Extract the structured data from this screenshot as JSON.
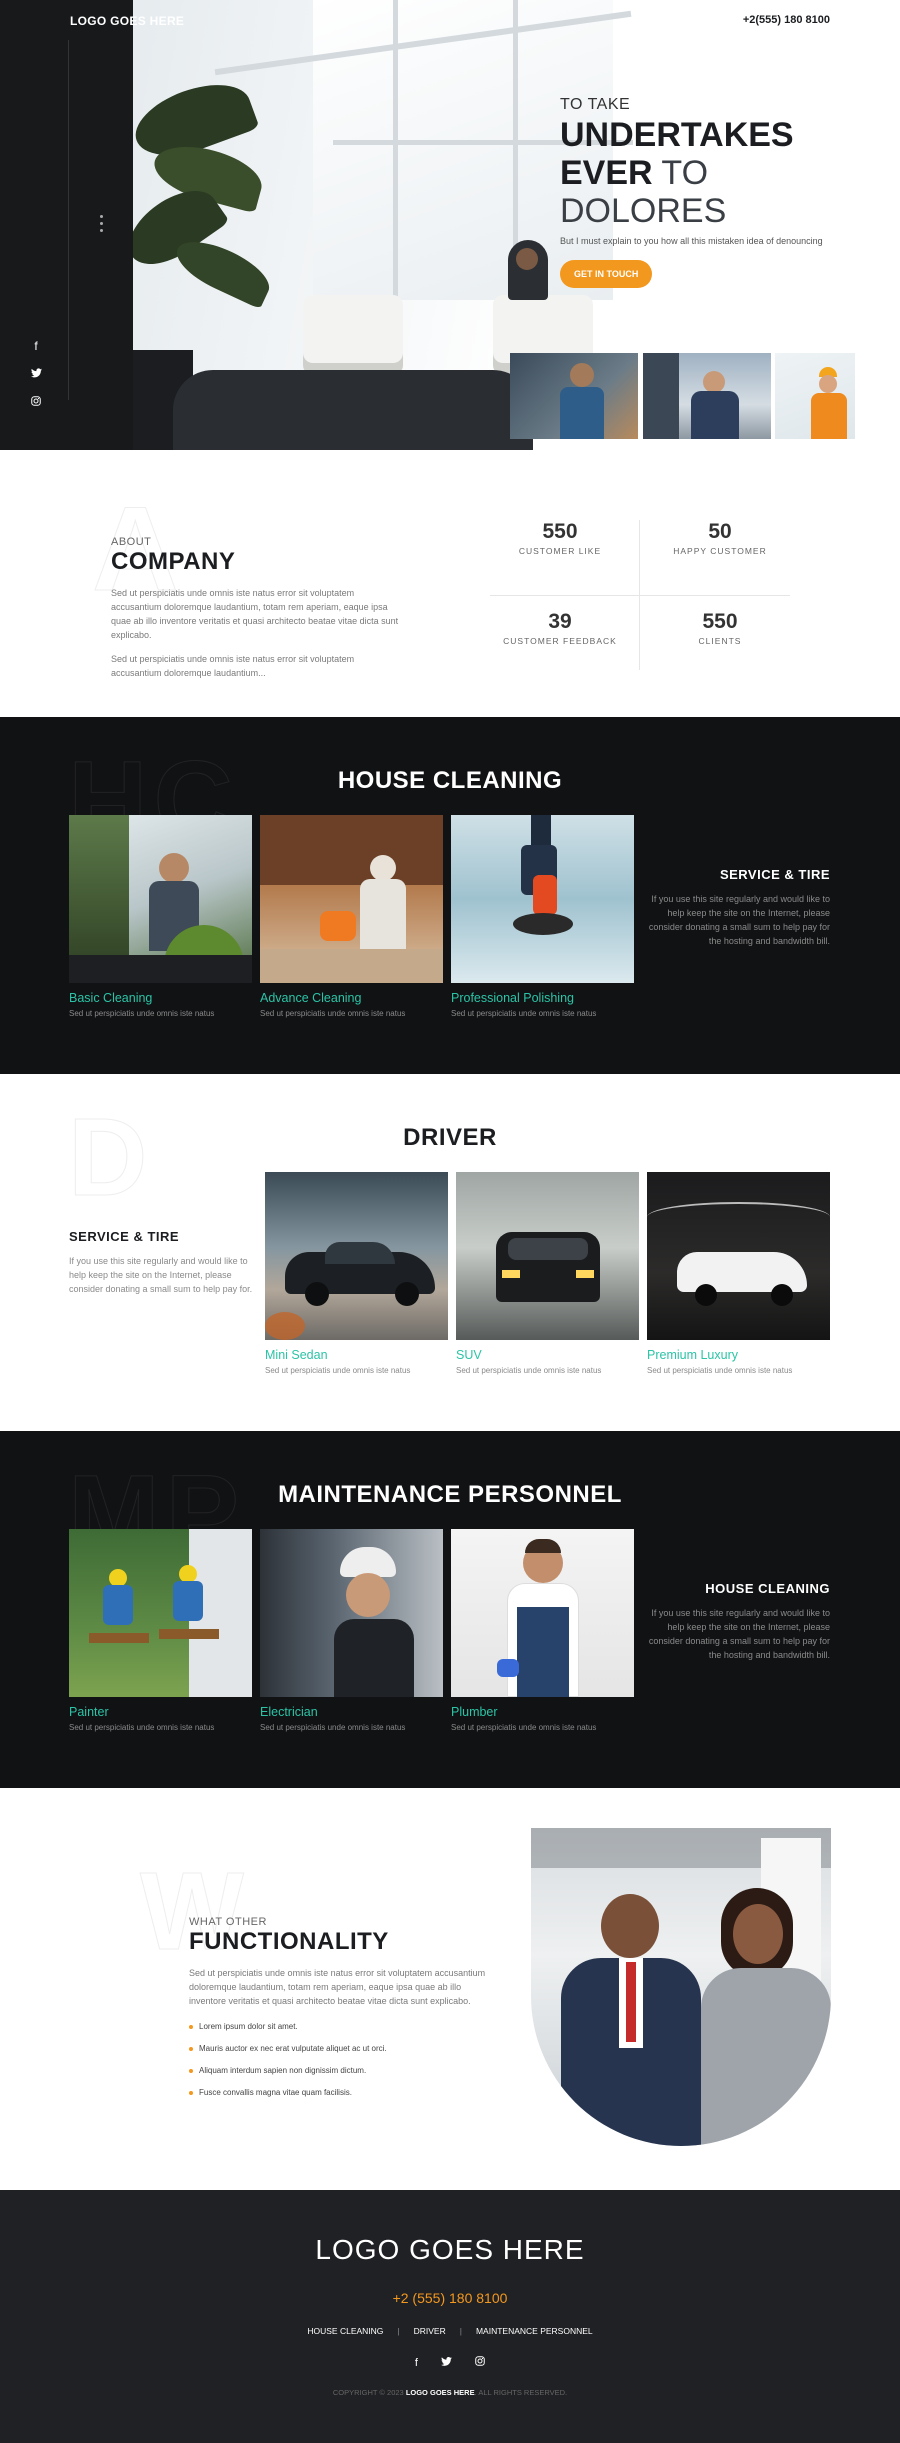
{
  "header": {
    "logo": "LOGO GOES HERE",
    "phone": "+2(555) 180 8100"
  },
  "hero": {
    "eyebrow": "TO TAKE",
    "title_line1": "UNDERTAKES",
    "title_line2_a": "EVER",
    "title_line2_b": " TO DOLORES",
    "subtitle": "But I must explain to you how all this mistaken idea of denouncing",
    "cta": "GET IN TOUCH"
  },
  "about": {
    "eyebrow": "ABOUT",
    "title": "COMPANY",
    "para1": "Sed ut perspiciatis unde omnis iste natus error sit voluptatem accusantium doloremque laudantium, totam rem aperiam, eaque ipsa quae ab illo inventore veritatis et quasi architecto beatae vitae dicta sunt explicabo.",
    "para2": "Sed ut perspiciatis unde omnis iste natus error sit voluptatem accusantium doloremque laudantium...",
    "stats": [
      {
        "num": "550",
        "label": "CUSTOMER LIKE"
      },
      {
        "num": "50",
        "label": "HAPPY CUSTOMER"
      },
      {
        "num": "39",
        "label": "CUSTOMER FEEDBACK"
      },
      {
        "num": "550",
        "label": "CLIENTS"
      }
    ]
  },
  "house_cleaning": {
    "title": "HOUSE CLEANING",
    "cards": [
      {
        "title": "Basic Cleaning",
        "desc": "Sed ut perspiciatis unde omnis iste natus"
      },
      {
        "title": "Advance Cleaning",
        "desc": "Sed ut perspiciatis unde omnis iste natus"
      },
      {
        "title": "Professional Polishing",
        "desc": "Sed ut perspiciatis unde omnis iste natus"
      }
    ],
    "side_title": "SERVICE & TIRE",
    "side_text": "If you use this site regularly and would like to help keep the site on the Internet, please consider donating a small sum to help pay for the hosting and bandwidth bill."
  },
  "driver": {
    "title": "DRIVER",
    "side_title": "SERVICE & TIRE",
    "side_text": "If you use this site regularly and would like to help keep the site on the Internet, please consider donating a small sum to help pay for.",
    "cards": [
      {
        "title": "Mini Sedan",
        "desc": "Sed ut perspiciatis unde omnis iste natus"
      },
      {
        "title": "SUV",
        "desc": "Sed ut perspiciatis unde omnis iste natus"
      },
      {
        "title": "Premium Luxury",
        "desc": "Sed ut perspiciatis unde omnis iste natus"
      }
    ]
  },
  "maintenance": {
    "title": "MAINTENANCE PERSONNEL",
    "cards": [
      {
        "title": "Painter",
        "desc": "Sed ut perspiciatis unde omnis iste natus"
      },
      {
        "title": "Electrician",
        "desc": "Sed ut perspiciatis unde omnis iste natus"
      },
      {
        "title": "Plumber",
        "desc": "Sed ut perspiciatis unde omnis iste natus"
      }
    ],
    "side_title": "HOUSE CLEANING",
    "side_text": "If you use this site regularly and would like to help keep the site on the Internet, please consider donating a small sum to help pay for the hosting and bandwidth bill."
  },
  "functionality": {
    "eyebrow": "WHAT OTHER",
    "title": "FUNCTIONALITY",
    "para": "Sed ut perspiciatis unde omnis iste natus error sit voluptatem accusantium doloremque laudantium, totam rem aperiam, eaque ipsa quae ab illo inventore veritatis et quasi architecto beatae vitae dicta sunt explicabo.",
    "bullets": [
      "Lorem ipsum dolor sit amet.",
      "Mauris auctor ex nec erat vulputate aliquet ac ut orci.",
      "Aliquam interdum sapien non dignissim dictum.",
      "Fusce convallis magna vitae quam facilisis."
    ]
  },
  "footer": {
    "logo": "LOGO GOES HERE",
    "phone": "+2 (555) 180 8100",
    "nav": [
      "HOUSE CLEANING",
      "DRIVER",
      "MAINTENANCE PERSONNEL"
    ],
    "separator": "|",
    "copy_prefix": "COPYRIGHT © 2023",
    "copy_brand": "LOGO GOES HERE",
    "copy_suffix": ". ALL RIGHTS RESERVED."
  },
  "icons": {
    "facebook": "facebook-icon",
    "twitter": "twitter-icon",
    "instagram": "instagram-icon"
  },
  "colors": {
    "accent_orange": "#f3981e",
    "accent_teal": "#2bc4a6",
    "dark_bg": "#111214",
    "footer_bg": "#202124"
  }
}
